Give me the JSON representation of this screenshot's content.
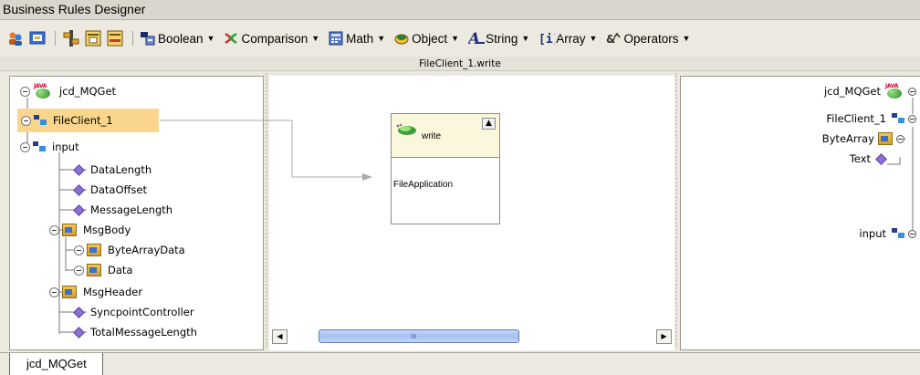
{
  "window": {
    "title": "Business Rules Designer"
  },
  "toolbar": {
    "menus": [
      {
        "label": "Boolean",
        "icon": "boolean-icon"
      },
      {
        "label": "Comparison",
        "icon": "comparison-icon"
      },
      {
        "label": "Math",
        "icon": "math-icon"
      },
      {
        "label": "Object",
        "icon": "object-icon"
      },
      {
        "label": "String",
        "icon": "string-icon"
      },
      {
        "label": "Array",
        "icon": "array-icon"
      },
      {
        "label": "Operators",
        "icon": "operators-icon"
      }
    ]
  },
  "canvas": {
    "title": "FileClient_1.write"
  },
  "left_tree": {
    "root": "jcd_MQGet",
    "file_client": "FileClient_1",
    "input": "input",
    "input_children": [
      "DataLength",
      "DataOffset",
      "MessageLength"
    ],
    "msg_body": "MsgBody",
    "msg_body_children": [
      "ByteArrayData",
      "Data"
    ],
    "msg_header": "MsgHeader",
    "tail_children": [
      "SyncpointController",
      "TotalMessageLength"
    ]
  },
  "method_box": {
    "title": "write",
    "param": "FileApplication"
  },
  "right_tree": {
    "root": "jcd_MQGet",
    "file_client": "FileClient_1",
    "byte_array": "ByteArray",
    "text": "Text",
    "input": "input"
  },
  "bottom_tab": {
    "label": "jcd_MQGet"
  },
  "colors": {
    "selection": "#f9d68b",
    "scroll_thumb": "#a6c1ef",
    "background": "#ece9e1"
  }
}
